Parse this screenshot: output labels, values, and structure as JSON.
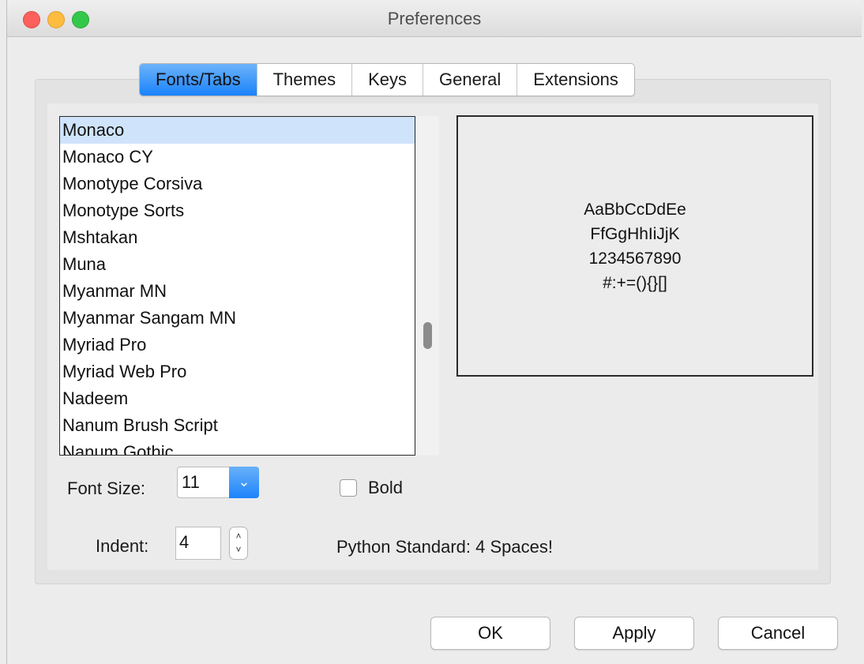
{
  "window": {
    "title": "Preferences"
  },
  "tabs": [
    {
      "label": "Fonts/Tabs",
      "active": true
    },
    {
      "label": "Themes",
      "active": false
    },
    {
      "label": "Keys",
      "active": false
    },
    {
      "label": "General",
      "active": false
    },
    {
      "label": "Extensions",
      "active": false
    }
  ],
  "font_list": {
    "selected_index": 0,
    "items": [
      "Monaco",
      "Monaco CY",
      "Monotype Corsiva",
      "Monotype Sorts",
      "Mshtakan",
      "Muna",
      "Myanmar MN",
      "Myanmar Sangam MN",
      "Myriad Pro",
      "Myriad Web Pro",
      "Nadeem",
      "Nanum Brush Script",
      "Nanum Gothic"
    ],
    "scroll_position": 0.66
  },
  "sample": {
    "lines": [
      "AaBbCcDdEe",
      "FfGgHhIiJjK",
      "1234567890",
      "#:+=(){}[]"
    ]
  },
  "font_size": {
    "label": "Font Size:",
    "value": "11"
  },
  "bold": {
    "label": "Bold",
    "checked": false
  },
  "indent": {
    "label": "Indent:",
    "value": "4",
    "note": "Python Standard: 4 Spaces!"
  },
  "buttons": {
    "ok": "OK",
    "apply": "Apply",
    "cancel": "Cancel"
  },
  "colors": {
    "accent": "#1a82fb",
    "selection": "#cfe3fb"
  },
  "icons": {
    "select_arrow": "chevron-down-icon",
    "stepper": "stepper-arrows-icon"
  }
}
